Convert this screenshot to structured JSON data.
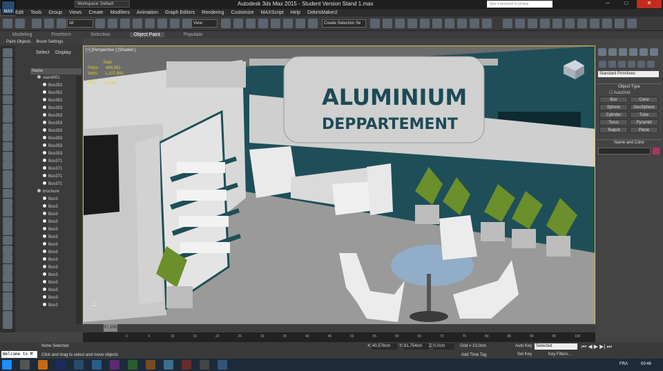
{
  "window": {
    "title": "Autodesk 3ds Max  2015  - Student Version   Stand 1.max",
    "workspace": "Workspace: Default",
    "search_placeholder": "Type a keyword or phrase",
    "app_logo": "MAX"
  },
  "menu": [
    "Edit",
    "Tools",
    "Group",
    "Views",
    "Create",
    "Modifiers",
    "Animation",
    "Graph Editors",
    "Rendering",
    "Customize",
    "MAXScript",
    "Help",
    "DebrisMaker2"
  ],
  "toolbar": {
    "filter": "All",
    "view": "View",
    "selection_set": "Create Selection Se"
  },
  "ribbon": {
    "tabs": [
      "Modeling",
      "Freeform",
      "Selection",
      "Object Paint",
      "Populate"
    ],
    "active": "Object Paint",
    "sub": [
      "Paint Objects",
      "Brush Settings"
    ]
  },
  "scene_explorer": {
    "tabs": [
      "Select",
      "Display"
    ],
    "header": "Name",
    "items": [
      "stand001",
      "Box352",
      "Box352",
      "Box352",
      "Box353",
      "Box353",
      "Box353",
      "Box353",
      "Box353",
      "Box353",
      "Box353",
      "Box371",
      "Box371",
      "Box371",
      "Box371",
      "brochure",
      "Box3",
      "Box3",
      "Box3",
      "Box3",
      "Box3",
      "Box3",
      "Box3",
      "Box3",
      "Box3",
      "Box3",
      "Box3",
      "Box3",
      "Box3",
      "Box3",
      "Box3"
    ]
  },
  "viewport": {
    "label": "[+] [Perspective ] [Shaded ]",
    "stats": {
      "total_label": "Total",
      "polys_label": "Polys:",
      "polys": "489,081",
      "verts_label": "Verts:",
      "verts": "1,107,941",
      "fps_label": "FPS:",
      "fps": "70,398"
    },
    "sign_line1": "ALUMINIUM",
    "sign_line2": "DEPPARTEMENT"
  },
  "command_panel": {
    "dropdown": "Standard Primitives",
    "object_type": "Object Type",
    "autogrid": "AutoGrid",
    "buttons": [
      "Box",
      "Cone",
      "Sphere",
      "GeoSphere",
      "Cylinder",
      "Tube",
      "Torus",
      "Pyramid",
      "Teapot",
      "Plane"
    ],
    "name_color": "Name and Color"
  },
  "timeline": {
    "frame": "0 / 100",
    "ticks": [
      "0",
      "5",
      "10",
      "15",
      "20",
      "25",
      "30",
      "35",
      "40",
      "45",
      "50",
      "55",
      "60",
      "65",
      "70",
      "75",
      "80",
      "85",
      "90",
      "95",
      "100"
    ]
  },
  "status": {
    "listener": "Welcome to M",
    "selection": "None Selected",
    "prompt": "Click and drag to select and move objects",
    "x_label": "X:",
    "x": "40,578cm",
    "y_label": "Y:",
    "y": "81,754cm",
    "z_label": "Z:",
    "z": "0,0cm",
    "grid": "Grid = 10,0cm",
    "add_time_tag": "Add Time Tag",
    "auto_key": "Auto Key",
    "set_key": "Set Key",
    "selected": "Selected",
    "key_filters": "Key Filters..."
  },
  "taskbar": {
    "lang": "FRA",
    "time": "00:46"
  },
  "colors": {
    "accent": "#d9c14a",
    "wall_teal": "#1e4f58",
    "sign_text": "#1c4a55"
  }
}
